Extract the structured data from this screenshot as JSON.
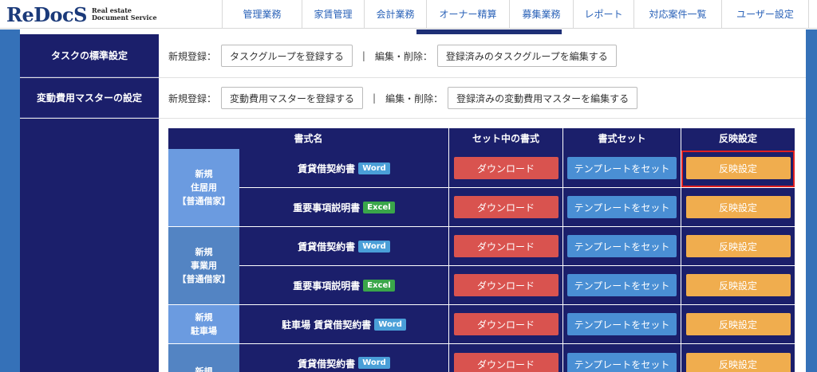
{
  "header": {
    "logo_re": "Re",
    "logo_docs": "DocS",
    "logo_sub1": "Real estate",
    "logo_sub2": "Document Service",
    "nav": [
      "管理業務",
      "家賃管理",
      "会計業務",
      "オーナー精算",
      "募集業務",
      "レポート",
      "対応案件一覧",
      "ユーザー設定"
    ]
  },
  "settings": {
    "task": {
      "label": "タスクの標準設定",
      "new_label": "新規登録：",
      "new_button": "タスクグループを登録する",
      "edit_label": "編集・削除：",
      "edit_button": "登録済みのタスクグループを編集する"
    },
    "variable_cost": {
      "label": "変動費用マスターの設定",
      "new_label": "新規登録：",
      "new_button": "変動費用マスターを登録する",
      "edit_label": "編集・削除：",
      "edit_button": "登録済みの変動費用マスターを編集する"
    },
    "separator": "|"
  },
  "table": {
    "headers": [
      "書式名",
      "セット中の書式",
      "書式セット",
      "反映設定"
    ],
    "groups": [
      {
        "lines": [
          "新規",
          "住居用",
          "【普通借家】"
        ]
      },
      {
        "lines": [
          "新規",
          "事業用",
          "【普通借家】"
        ]
      },
      {
        "lines": [
          "新規",
          "駐車場"
        ]
      },
      {
        "lines": [
          "新規"
        ]
      }
    ],
    "rows": [
      {
        "name": "賃貸借契約書",
        "badge": "Word",
        "download": "ダウンロード",
        "template": "テンプレートをセット",
        "apply": "反映設定"
      },
      {
        "name": "重要事項説明書",
        "badge": "Excel",
        "download": "ダウンロード",
        "template": "テンプレートをセット",
        "apply": "反映設定"
      },
      {
        "name": "賃貸借契約書",
        "badge": "Word",
        "download": "ダウンロード",
        "template": "テンプレートをセット",
        "apply": "反映設定"
      },
      {
        "name": "重要事項説明書",
        "badge": "Excel",
        "download": "ダウンロード",
        "template": "テンプレートをセット",
        "apply": "反映設定"
      },
      {
        "name": "駐車場 賃貸借契約書",
        "badge": "Word",
        "download": "ダウンロード",
        "template": "テンプレートをセット",
        "apply": "反映設定"
      },
      {
        "name": "賃貸借契約書",
        "badge": "Word",
        "download": "ダウンロード",
        "template": "テンプレートをセット",
        "apply": "反映設定"
      }
    ]
  },
  "colors": {
    "navy": "#1b1f6b",
    "header_blue": "#3571b8",
    "download": "#d9534f",
    "template": "#4a8fd4",
    "apply": "#f0ad4e",
    "highlight": "#e02020"
  }
}
